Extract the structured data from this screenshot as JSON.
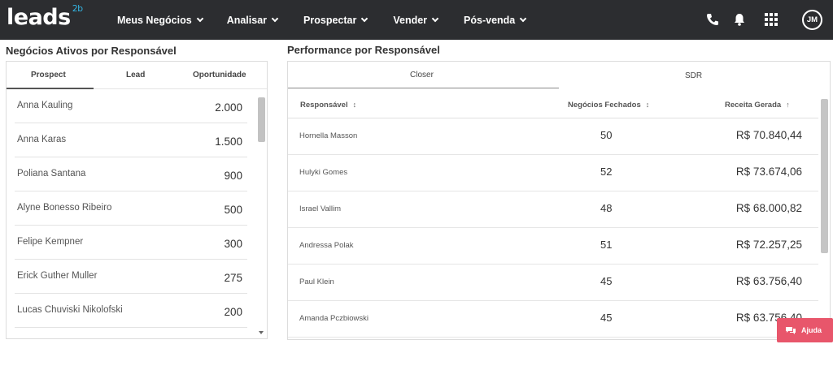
{
  "app": {
    "logo_text": "leads",
    "logo_sup": "2b",
    "brand_accent": "#34b3e0",
    "header_bg": "#2c2d30"
  },
  "nav": {
    "items": [
      {
        "label": "Meus Negócios"
      },
      {
        "label": "Analisar"
      },
      {
        "label": "Prospectar"
      },
      {
        "label": "Vender"
      },
      {
        "label": "Pós-venda"
      }
    ]
  },
  "header_icons": [
    "phone-icon",
    "bell-icon",
    "apps-grid-icon"
  ],
  "user": {
    "initials": "JM"
  },
  "left_panel": {
    "title": "Negócios Ativos por Responsável",
    "tabs": [
      {
        "label": "Prospect",
        "active": true
      },
      {
        "label": "Lead",
        "active": false
      },
      {
        "label": "Oportunidade",
        "active": false
      }
    ],
    "rows": [
      {
        "name": "Anna Kauling",
        "value": "2.000"
      },
      {
        "name": "Anna Karas",
        "value": "1.500"
      },
      {
        "name": "Poliana Santana",
        "value": "900"
      },
      {
        "name": "Alyne Bonesso Ribeiro",
        "value": "500"
      },
      {
        "name": "Felipe Kempner",
        "value": "300"
      },
      {
        "name": "Erick Guther Muller",
        "value": "275"
      },
      {
        "name": "Lucas Chuviski Nikolofski",
        "value": "200"
      }
    ]
  },
  "right_panel": {
    "title": "Performance por Responsável",
    "tabs": [
      {
        "label": "Closer",
        "active": true
      },
      {
        "label": "SDR",
        "active": false
      }
    ],
    "columns": {
      "responsavel": "Responsável",
      "fechados": "Negócios Fechados",
      "receita": "Receita Gerada"
    },
    "rows": [
      {
        "name": "Hornella Masson",
        "closed": "50",
        "revenue": "R$ 70.840,44"
      },
      {
        "name": "Hulyki Gomes",
        "closed": "52",
        "revenue": "R$ 73.674,06"
      },
      {
        "name": "Israel Vallim",
        "closed": "48",
        "revenue": "R$ 68.000,82"
      },
      {
        "name": "Andressa Polak",
        "closed": "51",
        "revenue": "R$ 72.257,25"
      },
      {
        "name": "Paul Klein",
        "closed": "45",
        "revenue": "R$ 63.756,40"
      },
      {
        "name": "Amanda Pczbiowski",
        "closed": "45",
        "revenue": "R$ 63.756,40"
      }
    ]
  },
  "help": {
    "label": "Ajuda",
    "color": "#e8566b"
  }
}
